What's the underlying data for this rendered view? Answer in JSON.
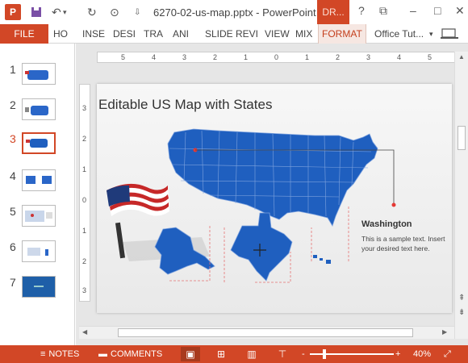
{
  "window": {
    "title": "6270-02-us-map.pptx - PowerPoint",
    "contextual_tab": "DR...",
    "help_icon": "?",
    "restore_icon": "restore-icon",
    "minimize_icon": "minimize-icon",
    "close_icon": "close-icon"
  },
  "ribbon": {
    "file": "FILE",
    "tabs": [
      "HO",
      "INSE",
      "DESI",
      "TRA",
      "ANI",
      "SLIDE",
      "REVI",
      "VIEW",
      "MIX",
      "FORMAT"
    ],
    "account": "Office Tut...",
    "active_color": "#d24726"
  },
  "thumbnails": [
    {
      "num": "1"
    },
    {
      "num": "2"
    },
    {
      "num": "3",
      "selected": true
    },
    {
      "num": "4"
    },
    {
      "num": "5"
    },
    {
      "num": "6"
    },
    {
      "num": "7"
    }
  ],
  "ruler": {
    "h_labels": [
      "5",
      "4",
      "3",
      "2",
      "1",
      "0",
      "1",
      "2",
      "3",
      "4",
      "5"
    ],
    "v_labels": [
      "3",
      "2",
      "1",
      "0",
      "1",
      "2",
      "3"
    ]
  },
  "slide": {
    "title": "Editable US Map with States",
    "callout_title": "Washington",
    "callout_text": "This is a sample text. Insert your desired text here.",
    "map_color": "#1f5fbf"
  },
  "status": {
    "notes": "NOTES",
    "comments": "COMMENTS",
    "zoom_minus": "-",
    "zoom_plus": "+",
    "zoom": "40%",
    "zoom_level": 0.4
  }
}
